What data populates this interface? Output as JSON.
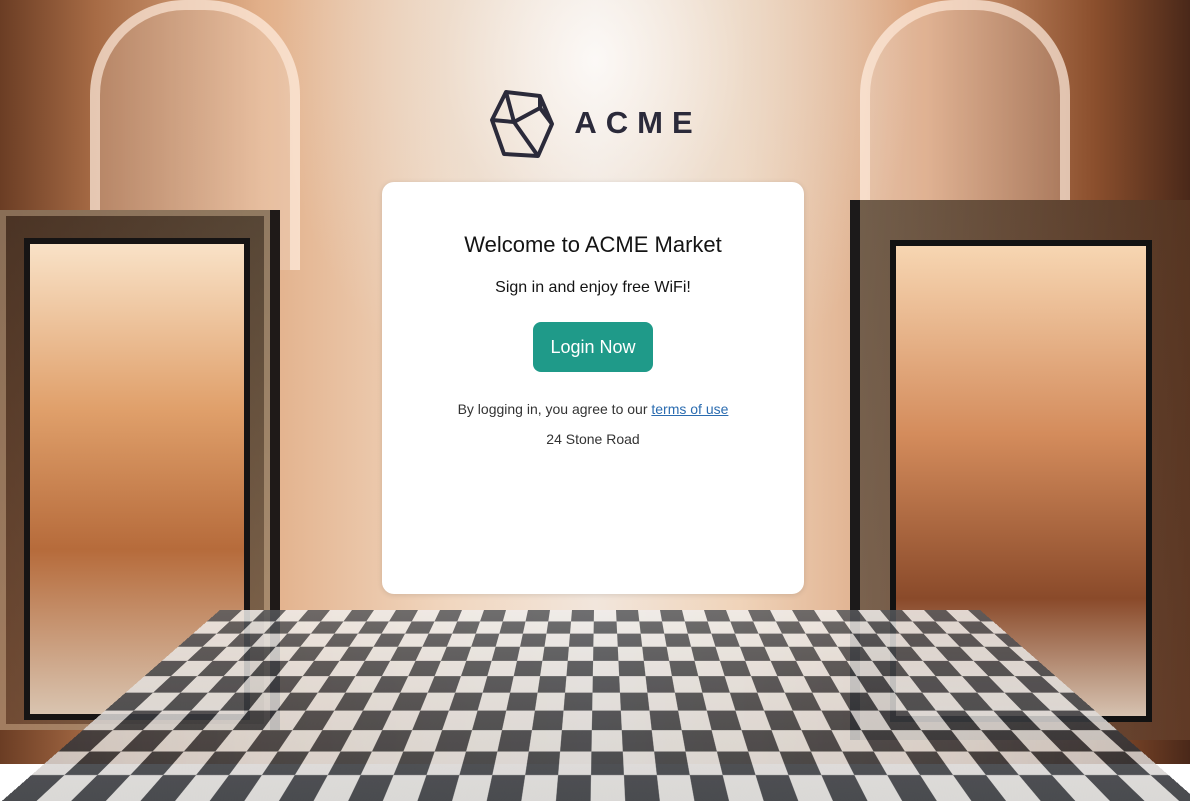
{
  "brand": {
    "name": "ACME",
    "color": "#2b2a3a",
    "logo_icon": "cube-icon"
  },
  "card": {
    "title": "Welcome to ACME Market",
    "subtitle": "Sign in and enjoy free WiFi!",
    "login_label": "Login Now",
    "terms_prefix": "By logging in, you agree to our",
    "terms_link_label": "terms of use",
    "address": "24 Stone Road"
  },
  "colors": {
    "primary_button": "#1f9a89",
    "link": "#2b6cb0"
  }
}
